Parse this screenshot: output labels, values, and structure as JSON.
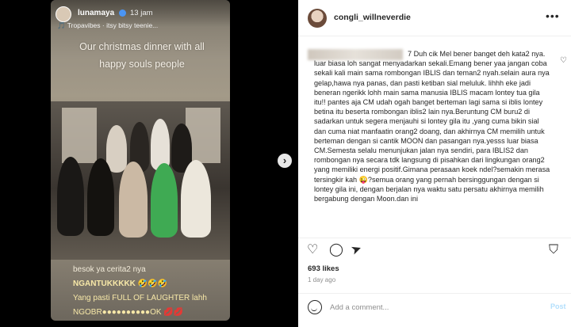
{
  "story": {
    "username": "lunamaya",
    "time": "13 jam",
    "music": "🎵 Tropavibes · itsy bitsy teenie...",
    "caption": "Our christmas dinner with all happy souls people",
    "line1": "besok ya cerita2 nya",
    "line2": "NGANTUKKKKK 🤣🤣🤣",
    "line3": "Yang pasti FULL OF LAUGHTER lahh",
    "line4": "NGOBR●●●●●●●●●●OK 💋💋"
  },
  "post": {
    "username": "congli_willneverdie",
    "more_icon": "more-horizontal-icon",
    "comment": "7 Duh cik Mel bener banget deh kata2 nya. luar biasa loh sangat menyadarkan sekali.Emang bener yaa jangan coba sekali kali main sama rombongan IBLIS dan teman2 nyah.selain aura nya gelap,hawa nya panas, dan pasti ketiban sial meluluk. lihhh eke jadi beneran ngerikk lohh main sama manusia IBLIS macam lontey tua gila itu!! pantes aja CM udah ogah banget berteman lagi sama si iblis lontey betina itu beserta rombongan iblis2 lain nya.Beruntung CM buru2 di sadarkan untuk segera menjauhi si lontey gila itu ,yang cuma bikin sial dan cuma niat manfaatin orang2 doang, dan akhirnya CM memilih untuk berteman dengan si cantik MOON dan pasangan nya.yesss luar biasa CM.Semesta selalu menunjukan jalan nya sendiri, para IBLIS2 dan rombongan nya secara tdk langsung di pisahkan dari lingkungan orang2 yang memiliki energi positif.Gimana perasaan koek ndel?semakin merasa tersingkir kah 😜?semua orang yang pernah bersinggungan dengan si lontey gila ini, dengan berjalan nya waktu satu persatu akhirnya memilih bergabung dengan Moon.dan ini",
    "likes": "693 likes",
    "ago": "1 day ago",
    "add_comment_placeholder": "Add a comment...",
    "post_label": "Post"
  }
}
